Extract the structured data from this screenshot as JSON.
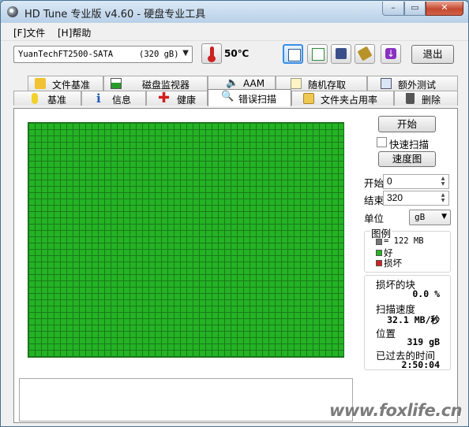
{
  "window": {
    "title": "HD Tune 专业版 v4.60 - 硬盘专业工具",
    "min": "–",
    "max": "▭",
    "close": "✕"
  },
  "menu": [
    "[F]文件",
    "[H]帮助"
  ],
  "toolbar": {
    "drive_name": "YuanTechFT2500-SATA",
    "drive_capacity": "(320 gB)",
    "temperature": "50℃",
    "exit_label": "退出",
    "buttons": [
      "copy-text-icon",
      "copy-screenshot-icon",
      "save-icon",
      "options-chip-icon",
      "download-icon"
    ]
  },
  "tabs_top": [
    "文件基准",
    "磁盘监视器",
    "AAM",
    "随机存取",
    "额外测试"
  ],
  "tabs_bottom": [
    "基准",
    "信息",
    "健康",
    "错误扫描",
    "文件夹占用率",
    "删除"
  ],
  "active_tab": "错误扫描",
  "scan": {
    "start_label": "开始",
    "quick_scan_label": "快速扫描",
    "quick_scan_checked": false,
    "map_label": "速度图",
    "start_field_label": "开始",
    "start_value": "0",
    "end_field_label": "结束",
    "end_value": "320",
    "unit_label": "单位",
    "unit_value": "gB"
  },
  "legend": {
    "title": "图例",
    "block_size": "= 122 MB",
    "good": "好",
    "damaged": "损坏",
    "colors": {
      "block": "#777777",
      "good": "#22b422",
      "damaged": "#cc2222"
    }
  },
  "stats": {
    "damaged_blocks_label": "损坏的块",
    "damaged_blocks_value": "0.0 %",
    "scan_speed_label": "扫描速度",
    "scan_speed_value": "32.1 MB/秒",
    "position_label": "位置",
    "position_value": "319 gB",
    "elapsed_label": "已过去的时间",
    "elapsed_value": "2:50:04"
  },
  "watermark": "www.foxlife.cn"
}
